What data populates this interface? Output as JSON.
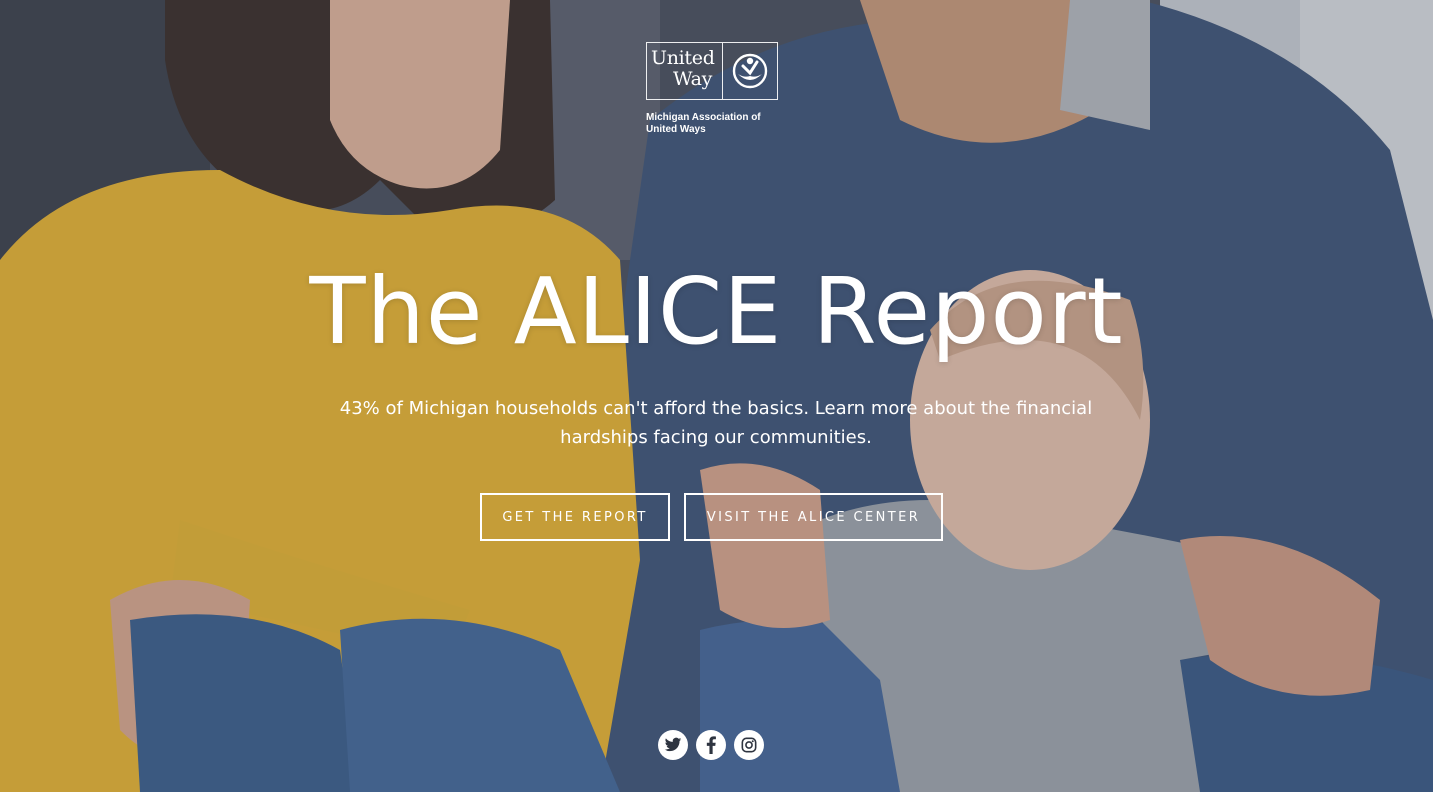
{
  "logo": {
    "word_line1": "United",
    "word_line2": "Way",
    "org_line1": "Michigan Association of",
    "org_line2": "United Ways"
  },
  "hero": {
    "title": "The ALICE Report",
    "subtitle_line1": "43% of Michigan households can't afford the basics. Learn more about the financial",
    "subtitle_line2": "hardships facing our communities."
  },
  "buttons": {
    "get_report": "GET THE REPORT",
    "visit_center": "VISIT THE ALICE CENTER"
  },
  "social": {
    "icons": [
      "twitter-icon",
      "facebook-icon",
      "instagram-icon"
    ]
  },
  "colors": {
    "text": "#ffffff",
    "sweater_yellow": "#e8b533",
    "sweater_blue": "#3f5678",
    "denim": "#3b5f8c"
  }
}
